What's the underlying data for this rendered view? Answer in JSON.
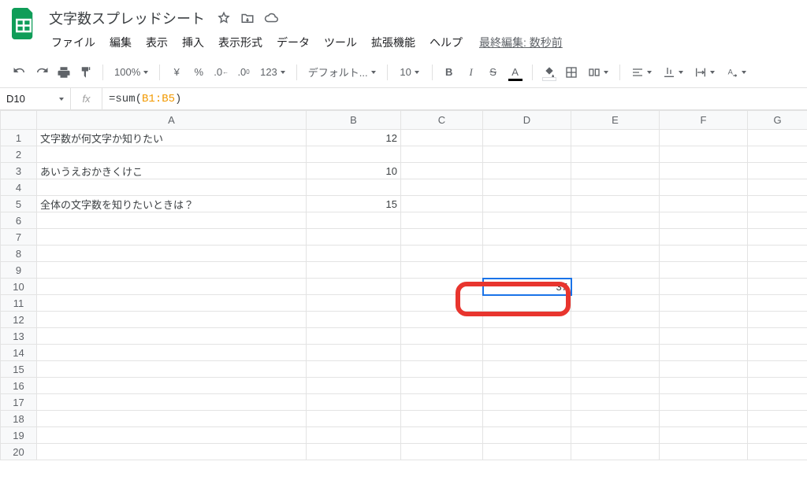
{
  "doc": {
    "title": "文字数スプレッドシート"
  },
  "menus": {
    "file": "ファイル",
    "edit": "編集",
    "view": "表示",
    "insert": "挿入",
    "format": "表示形式",
    "data": "データ",
    "tools": "ツール",
    "extensions": "拡張機能",
    "help": "ヘルプ",
    "last_edit": "最終編集: 数秒前"
  },
  "toolbar": {
    "zoom": "100%",
    "font": "デフォルト...",
    "size": "10",
    "more": "123"
  },
  "formula": {
    "cell_ref": "D10",
    "fx": "fx",
    "prefix": "=sum(",
    "range": "B1:B5",
    "suffix": ")"
  },
  "columns": [
    "A",
    "B",
    "C",
    "D",
    "E",
    "F",
    "G"
  ],
  "rows": [
    {
      "n": "1",
      "A": "文字数が何文字か知りたい",
      "B": "12"
    },
    {
      "n": "2"
    },
    {
      "n": "3",
      "A": "あいうえおかきくけこ",
      "B": "10"
    },
    {
      "n": "4"
    },
    {
      "n": "5",
      "A": "全体の文字数を知りたいときは？",
      "B": "15"
    },
    {
      "n": "6"
    },
    {
      "n": "7"
    },
    {
      "n": "8"
    },
    {
      "n": "9"
    },
    {
      "n": "10",
      "D": "37"
    },
    {
      "n": "11"
    },
    {
      "n": "12"
    },
    {
      "n": "13"
    },
    {
      "n": "14"
    },
    {
      "n": "15"
    },
    {
      "n": "16"
    },
    {
      "n": "17"
    },
    {
      "n": "18"
    },
    {
      "n": "19"
    },
    {
      "n": "20"
    }
  ],
  "selected": {
    "row": 10,
    "col": "D"
  }
}
